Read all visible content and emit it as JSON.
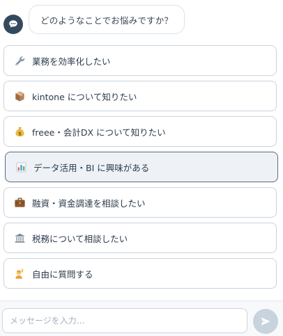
{
  "chat": {
    "bot_message": "どのようなことでお悩みですか？",
    "options": [
      {
        "label": "業務を効率化したい",
        "icon": "wrench-icon"
      },
      {
        "label": "kintone について知りたい",
        "icon": "package-icon"
      },
      {
        "label": "freee・会計DX について知りたい",
        "icon": "money-bag-icon"
      },
      {
        "label": "データ活用・BI に興味がある",
        "icon": "bar-chart-icon",
        "selected": true
      },
      {
        "label": "融資・資金調達を相談したい",
        "icon": "briefcase-icon"
      },
      {
        "label": "税務について相談したい",
        "icon": "bank-icon"
      },
      {
        "label": "自由に質問する",
        "icon": "raising-hand-icon"
      }
    ]
  },
  "composer": {
    "placeholder": "メッセージを入力...",
    "value": ""
  },
  "colors": {
    "avatar": "#34495e",
    "selected_border": "#5a6b7d",
    "send_button": "#c8d3de"
  }
}
